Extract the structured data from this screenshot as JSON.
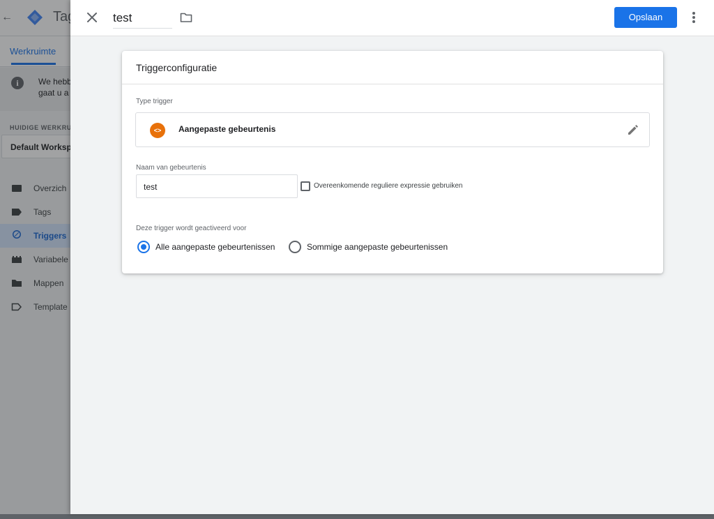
{
  "background_app": {
    "title": "Tag",
    "back_icon": "arrow-left-icon",
    "tab": "Werkruimte",
    "notice_text": "We hebb gaat u a",
    "workspace_label": "HUIDIGE WERKRUI",
    "workspace_name": "Default Worksp",
    "nav": [
      {
        "label": "Overzich",
        "icon": "overview-icon"
      },
      {
        "label": "Tags",
        "icon": "tag-icon"
      },
      {
        "label": "Triggers",
        "icon": "trigger-icon",
        "active": true
      },
      {
        "label": "Variabele",
        "icon": "variables-icon"
      },
      {
        "label": "Mappen",
        "icon": "folder-icon"
      },
      {
        "label": "Template",
        "icon": "template-icon"
      }
    ]
  },
  "panel": {
    "name": "test",
    "save_label": "Opslaan",
    "close_icon": "close-icon",
    "folder_icon": "folder-icon",
    "more_icon": "more-vert-icon"
  },
  "card": {
    "title": "Triggerconfiguratie",
    "type_label": "Type trigger",
    "type_value": "Aangepaste gebeurtenis",
    "type_icon": "code-brackets-icon",
    "event_name_label": "Naam van gebeurtenis",
    "event_name_value": "test",
    "regex_checkbox_label": "Overeenkomende reguliere expressie gebruiken",
    "regex_checked": false,
    "fires_on_label": "Deze trigger wordt geactiveerd voor",
    "fires_on_options": [
      {
        "label": "Alle aangepaste gebeurtenissen",
        "selected": true
      },
      {
        "label": "Sommige aangepaste gebeurtenissen",
        "selected": false
      }
    ]
  },
  "colors": {
    "accent": "#1a73e8",
    "trigger_orange": "#e8710a"
  }
}
